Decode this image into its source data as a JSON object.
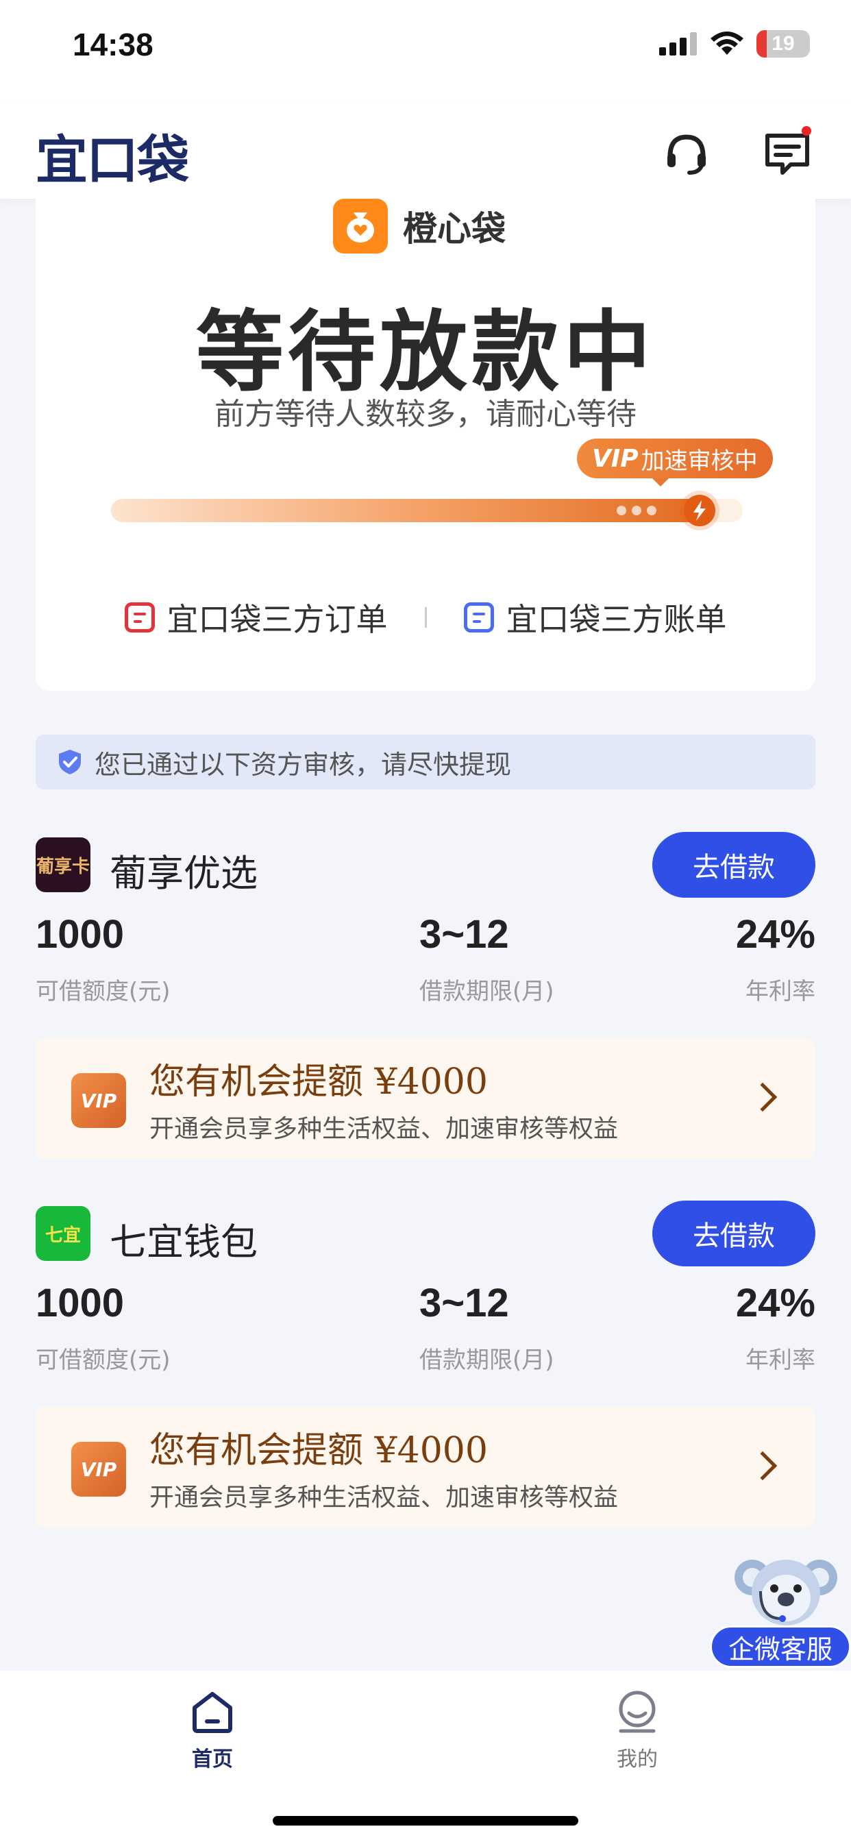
{
  "status_bar": {
    "time": "14:38",
    "battery_level": "19",
    "battery_fraction": 0.19,
    "icons": [
      "signal-icon",
      "wifi-icon",
      "battery-icon"
    ]
  },
  "header": {
    "brand": "宜口袋",
    "icons": [
      "headset-icon",
      "message-icon"
    ],
    "has_notification": true
  },
  "status_card": {
    "lender_name": "橙心袋",
    "title": "等待放款中",
    "subtitle": "前方等待人数较多，请耐心等待",
    "vip_tag_prefix": "VIP",
    "vip_tag_text": "加速审核中",
    "progress_fraction": 0.95,
    "links": [
      {
        "label": "宜口袋三方订单",
        "color": "#e2343a"
      },
      {
        "label": "宜口袋三方账单",
        "color": "#4a6cf0"
      }
    ]
  },
  "notice": {
    "text": "您已通过以下资方审核，请尽快提现",
    "icon": "shield-check-icon"
  },
  "offers": [
    {
      "logo_text": "葡享卡",
      "name": "葡享优选",
      "button": "去借款",
      "amount_value": "1000",
      "amount_label": "可借额度(元)",
      "term_value": "3~12",
      "term_label": "借款期限(月)",
      "rate_value": "24%",
      "rate_label": "年利率",
      "upgrade_badge": "VIP",
      "upgrade_title": "您有机会提额 ¥4000",
      "upgrade_sub": "开通会员享多种生活权益、加速审核等权益"
    },
    {
      "logo_text": "七宜",
      "name": "七宜钱包",
      "button": "去借款",
      "amount_value": "1000",
      "amount_label": "可借额度(元)",
      "term_value": "3~12",
      "term_label": "借款期限(月)",
      "rate_value": "24%",
      "rate_label": "年利率",
      "upgrade_badge": "VIP",
      "upgrade_title": "您有机会提额 ¥4000",
      "upgrade_sub": "开通会员享多种生活权益、加速审核等权益"
    }
  ],
  "service_float": {
    "label": "企微客服",
    "icon": "koala-mascot-icon"
  },
  "tabbar": {
    "tabs": [
      {
        "label": "首页",
        "icon": "home-icon",
        "active": true
      },
      {
        "label": "我的",
        "icon": "profile-icon",
        "active": false
      }
    ]
  },
  "colors": {
    "brand": "#1c2a66",
    "primary_button": "#2f4fe6",
    "accent_orange": "#e26a1e",
    "upgrade_text": "#7a3e0e"
  }
}
